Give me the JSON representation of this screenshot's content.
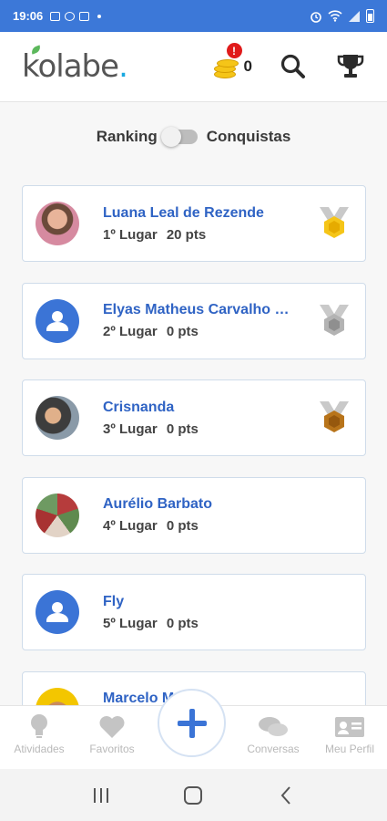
{
  "status_bar": {
    "time": "19:06"
  },
  "header": {
    "logo_text": "kolabe",
    "logo_dot": ".",
    "coins_badge": "!",
    "coins_count": "0",
    "search_icon": "search-icon",
    "trophy_icon": "trophy-icon"
  },
  "toggle": {
    "left_label": "Ranking",
    "right_label": "Conquistas",
    "state": "off"
  },
  "ranking": [
    {
      "name": "Luana Leal de Rezende",
      "place": "1º Lugar",
      "points": "20 pts",
      "medal": "gold"
    },
    {
      "name": "Elyas Matheus Carvalho Pe...",
      "place": "2º Lugar",
      "points": "0 pts",
      "medal": "silver"
    },
    {
      "name": "Crisnanda",
      "place": "3º Lugar",
      "points": "0 pts",
      "medal": "bronze"
    },
    {
      "name": "Aurélio Barbato",
      "place": "4º Lugar",
      "points": "0 pts",
      "medal": ""
    },
    {
      "name": "Fly",
      "place": "5º Lugar",
      "points": "0 pts",
      "medal": ""
    },
    {
      "name": "Marcelo M... y",
      "place": "",
      "points": "",
      "medal": ""
    }
  ],
  "bottom_nav": {
    "atividades": "Atividades",
    "favoritos": "Favoritos",
    "conversas": "Conversas",
    "meu_perfil": "Meu Perfil"
  },
  "colors": {
    "primary": "#3c78d8",
    "link": "#2f63c4",
    "gold": "#f5c518",
    "silver": "#a9a9a9",
    "bronze": "#b8741a"
  }
}
